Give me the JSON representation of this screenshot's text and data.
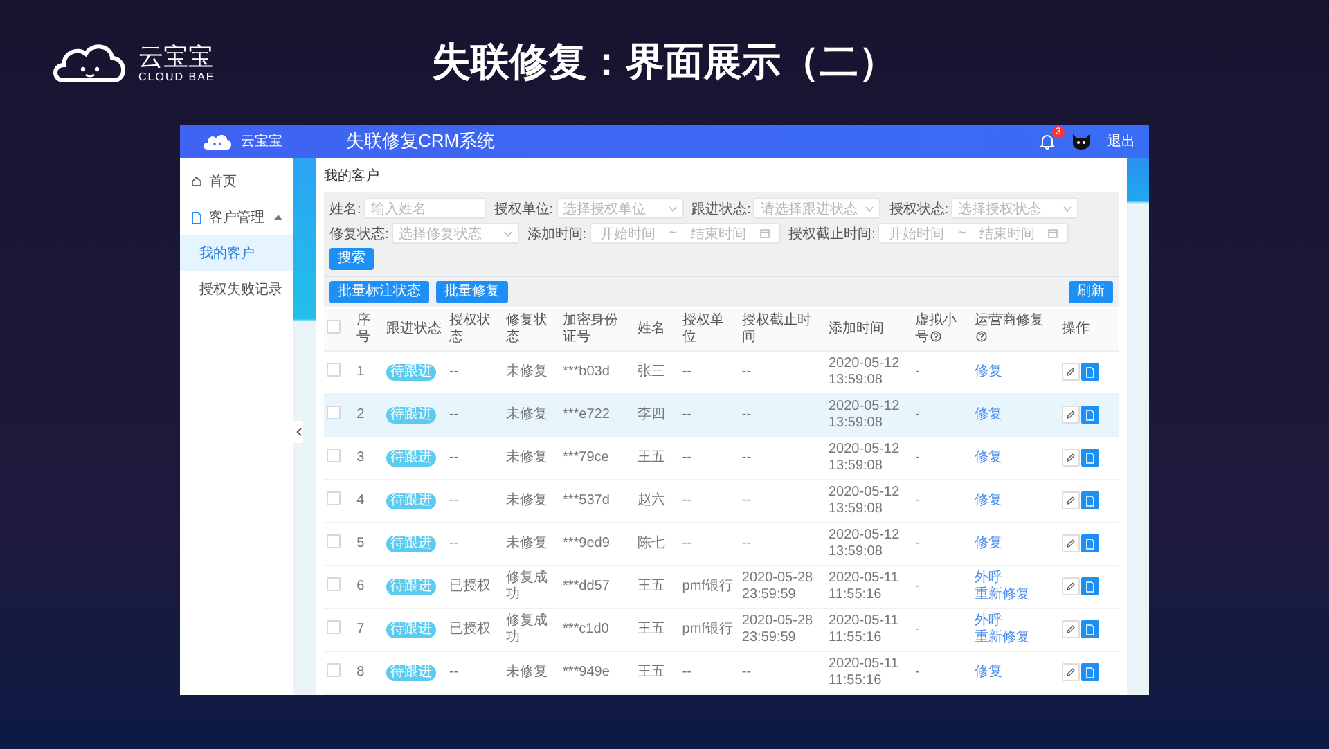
{
  "slide": {
    "logo_text": "云宝宝",
    "logo_subtext": "CLOUD BAE",
    "title": "失联修复：界面展示（二）"
  },
  "app": {
    "header": {
      "logo_text": "云宝宝",
      "title": "失联修复CRM系统",
      "notification_count": "3",
      "logout": "退出"
    },
    "sidebar": {
      "items": [
        {
          "label": "首页",
          "kind": "home",
          "selected": false
        },
        {
          "label": "客户管理",
          "kind": "document",
          "selected": false,
          "expanded": true,
          "children": [
            {
              "label": "我的客户",
              "selected": true
            },
            {
              "label": "授权失败记录",
              "selected": false
            }
          ]
        }
      ]
    },
    "page_title": "我的客户",
    "filter_rows": [
      [
        {
          "kind": "input",
          "label": "姓名:",
          "placeholder": "输入姓名"
        },
        {
          "kind": "select",
          "label": "授权单位:",
          "placeholder": "选择授权单位"
        },
        {
          "kind": "select",
          "label": "跟进状态:",
          "placeholder": "请选择跟进状态"
        },
        {
          "kind": "select",
          "label": "授权状态:",
          "placeholder": "选择授权状态"
        }
      ],
      [
        {
          "kind": "select",
          "label": "修复状态:",
          "placeholder": "选择修复状态"
        },
        {
          "kind": "daterange",
          "label": "添加时间:",
          "start_placeholder": "开始时间",
          "separator": "~",
          "end_placeholder": "结束时间"
        },
        {
          "kind": "daterange",
          "label": "授权截止时间:",
          "start_placeholder": "开始时间",
          "separator": "~",
          "end_placeholder": "结束时间"
        }
      ]
    ],
    "search_button": "搜索",
    "bulk_actions": [
      "批量标注状态",
      "批量修复"
    ],
    "refresh_button": "刷新",
    "table": {
      "select_all_checked": false,
      "columns": [
        {
          "label": "序号"
        },
        {
          "label": "跟进状态"
        },
        {
          "label": "授权状态"
        },
        {
          "label": "修复状态"
        },
        {
          "label": "加密身份证号"
        },
        {
          "label": "姓名"
        },
        {
          "label": "授权单位"
        },
        {
          "label": "授权截止时间"
        },
        {
          "label": "添加时间"
        },
        {
          "label": "虚拟小号",
          "help": true
        },
        {
          "label": "运营商修复",
          "help": true
        },
        {
          "label": "操作"
        }
      ],
      "rows": [
        {
          "checked": false,
          "highlighted": false,
          "index": "1",
          "follow_status": "待跟进",
          "auth_status": "--",
          "repair_status": "未修复",
          "id_number": "***b03d",
          "name": "张三",
          "auth_unit": "--",
          "auth_deadline": "--",
          "added_time": "2020-05-12 13:59:08",
          "virtual_number": "-",
          "repair_actions": [
            "修复"
          ]
        },
        {
          "checked": false,
          "highlighted": true,
          "index": "2",
          "follow_status": "待跟进",
          "auth_status": "--",
          "repair_status": "未修复",
          "id_number": "***e722",
          "name": "李四",
          "auth_unit": "--",
          "auth_deadline": "--",
          "added_time": "2020-05-12 13:59:08",
          "virtual_number": "-",
          "repair_actions": [
            "修复"
          ]
        },
        {
          "checked": false,
          "highlighted": false,
          "index": "3",
          "follow_status": "待跟进",
          "auth_status": "--",
          "repair_status": "未修复",
          "id_number": "***79ce",
          "name": "王五",
          "auth_unit": "--",
          "auth_deadline": "--",
          "added_time": "2020-05-12 13:59:08",
          "virtual_number": "-",
          "repair_actions": [
            "修复"
          ]
        },
        {
          "checked": false,
          "highlighted": false,
          "index": "4",
          "follow_status": "待跟进",
          "auth_status": "--",
          "repair_status": "未修复",
          "id_number": "***537d",
          "name": "赵六",
          "auth_unit": "--",
          "auth_deadline": "--",
          "added_time": "2020-05-12 13:59:08",
          "virtual_number": "-",
          "repair_actions": [
            "修复"
          ]
        },
        {
          "checked": false,
          "highlighted": false,
          "index": "5",
          "follow_status": "待跟进",
          "auth_status": "--",
          "repair_status": "未修复",
          "id_number": "***9ed9",
          "name": "陈七",
          "auth_unit": "--",
          "auth_deadline": "--",
          "added_time": "2020-05-12 13:59:08",
          "virtual_number": "-",
          "repair_actions": [
            "修复"
          ]
        },
        {
          "checked": false,
          "highlighted": false,
          "index": "6",
          "follow_status": "待跟进",
          "auth_status": "已授权",
          "repair_status": "修复成功",
          "id_number": "***dd57",
          "name": "王五",
          "auth_unit": "pmf银行",
          "auth_deadline": "2020-05-28 23:59:59",
          "added_time": "2020-05-11 11:55:16",
          "virtual_number": "-",
          "repair_actions": [
            "外呼",
            "重新修复"
          ]
        },
        {
          "checked": false,
          "highlighted": false,
          "index": "7",
          "follow_status": "待跟进",
          "auth_status": "已授权",
          "repair_status": "修复成功",
          "id_number": "***c1d0",
          "name": "王五",
          "auth_unit": "pmf银行",
          "auth_deadline": "2020-05-28 23:59:59",
          "added_time": "2020-05-11 11:55:16",
          "virtual_number": "-",
          "repair_actions": [
            "外呼",
            "重新修复"
          ]
        },
        {
          "checked": false,
          "highlighted": false,
          "index": "8",
          "follow_status": "待跟进",
          "auth_status": "--",
          "repair_status": "未修复",
          "id_number": "***949e",
          "name": "王五",
          "auth_unit": "--",
          "auth_deadline": "--",
          "added_time": "2020-05-11 11:55:16",
          "virtual_number": "-",
          "repair_actions": [
            "修复"
          ]
        }
      ]
    }
  }
}
